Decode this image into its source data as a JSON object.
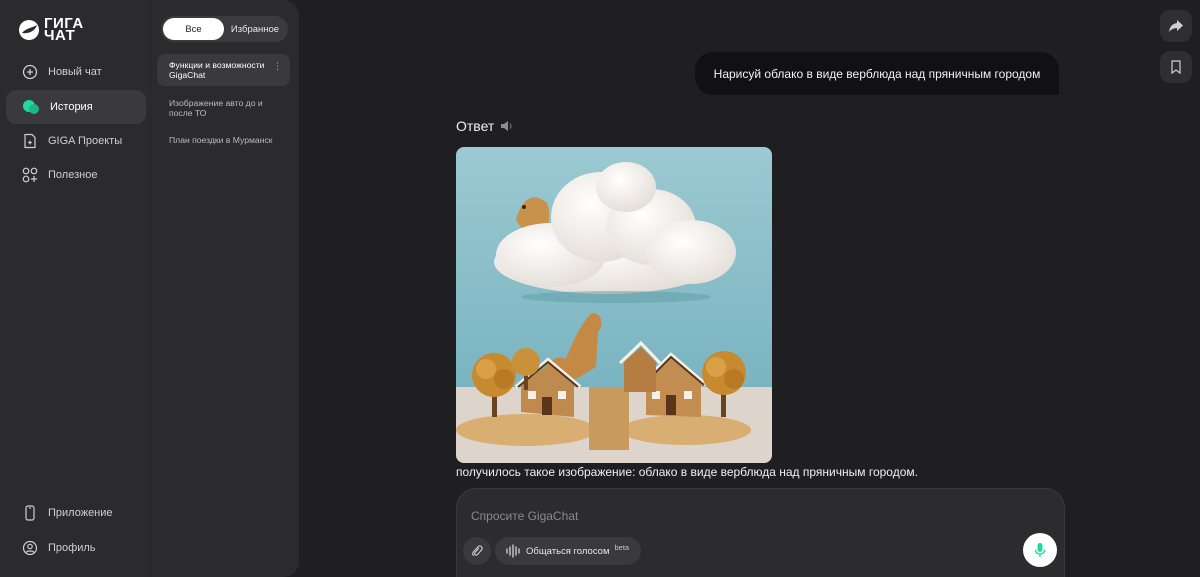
{
  "app": {
    "logo_text": "ГИГА ЧАТ",
    "accent_color": "#21d99a"
  },
  "nav": {
    "items": [
      {
        "label": "Новый чат",
        "icon": "plus-circle-icon"
      },
      {
        "label": "История",
        "icon": "chat-bubbles-icon",
        "active": true
      },
      {
        "label": "GIGA Проекты",
        "icon": "document-sparkle-icon"
      },
      {
        "label": "Полезное",
        "icon": "apps-icon"
      }
    ],
    "bottom_items": [
      {
        "label": "Приложение",
        "icon": "phone-icon"
      },
      {
        "label": "Профиль",
        "icon": "user-circle-icon"
      }
    ]
  },
  "history": {
    "filter_tabs": [
      {
        "label": "Все",
        "selected": true
      },
      {
        "label": "Избранное",
        "selected": false
      }
    ],
    "items": [
      {
        "title": "Функции и возможности GigaChat",
        "active": true
      },
      {
        "title": "Изображение авто до и после ТО",
        "active": false
      },
      {
        "title": "План поездки в Мурманск",
        "active": false
      }
    ]
  },
  "chat": {
    "user_message": "Нарисуй облако в виде верблюда над пряничным городом",
    "answer_label": "Ответ",
    "answer_text": "получилось такое изображение: облако в виде верблюда над пряничным городом."
  },
  "composer": {
    "placeholder": "Спросите GigaChat",
    "voice_label": "Общаться голосом",
    "voice_badge": "beta"
  }
}
